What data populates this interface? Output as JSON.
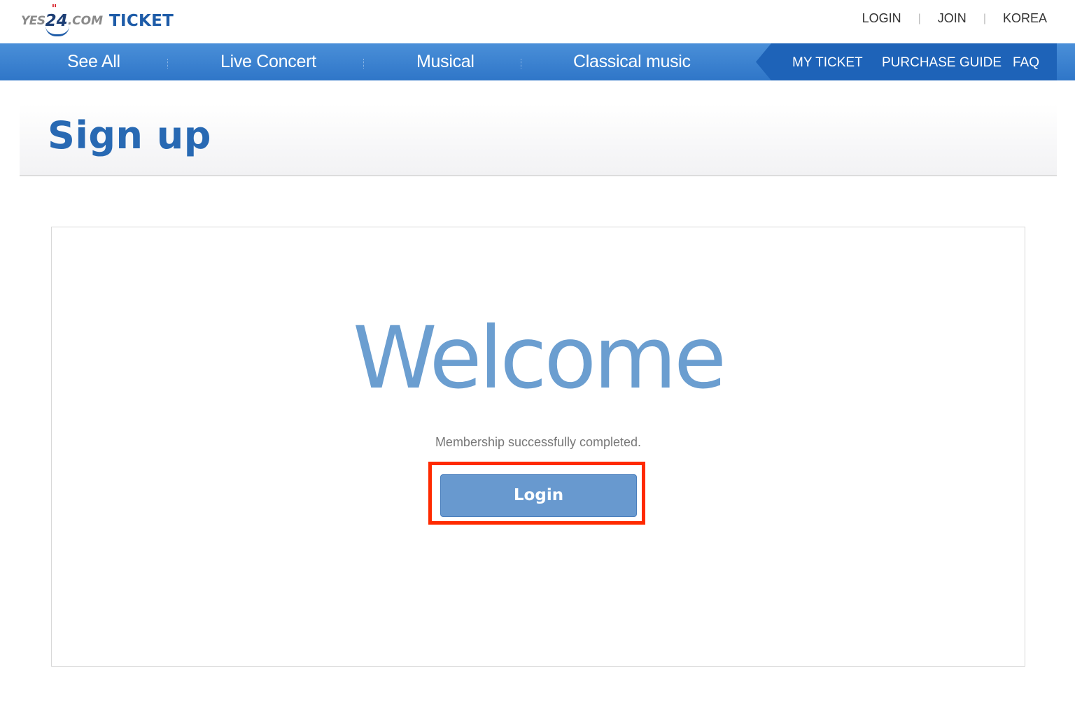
{
  "logo": {
    "yes": "YES",
    "num": "24",
    "com": ".COM",
    "ticket": "TICKET",
    "quote_mark": "\""
  },
  "util": {
    "login": "LOGIN",
    "join": "JOIN",
    "korea": "KOREA",
    "separator": "|"
  },
  "nav": {
    "main": [
      "See All",
      "Live Concert",
      "Musical",
      "Classical music"
    ],
    "right": [
      "MY TICKET",
      "PURCHASE GUIDE",
      "FAQ"
    ]
  },
  "page": {
    "title": "Sign up"
  },
  "panel": {
    "welcome": "Welcome",
    "message": "Membership successfully completed.",
    "login_button": "Login"
  },
  "colors": {
    "accent": "#2f76c8",
    "title": "#2869b3",
    "button": "#6899cf",
    "highlight": "#ff2a00"
  }
}
